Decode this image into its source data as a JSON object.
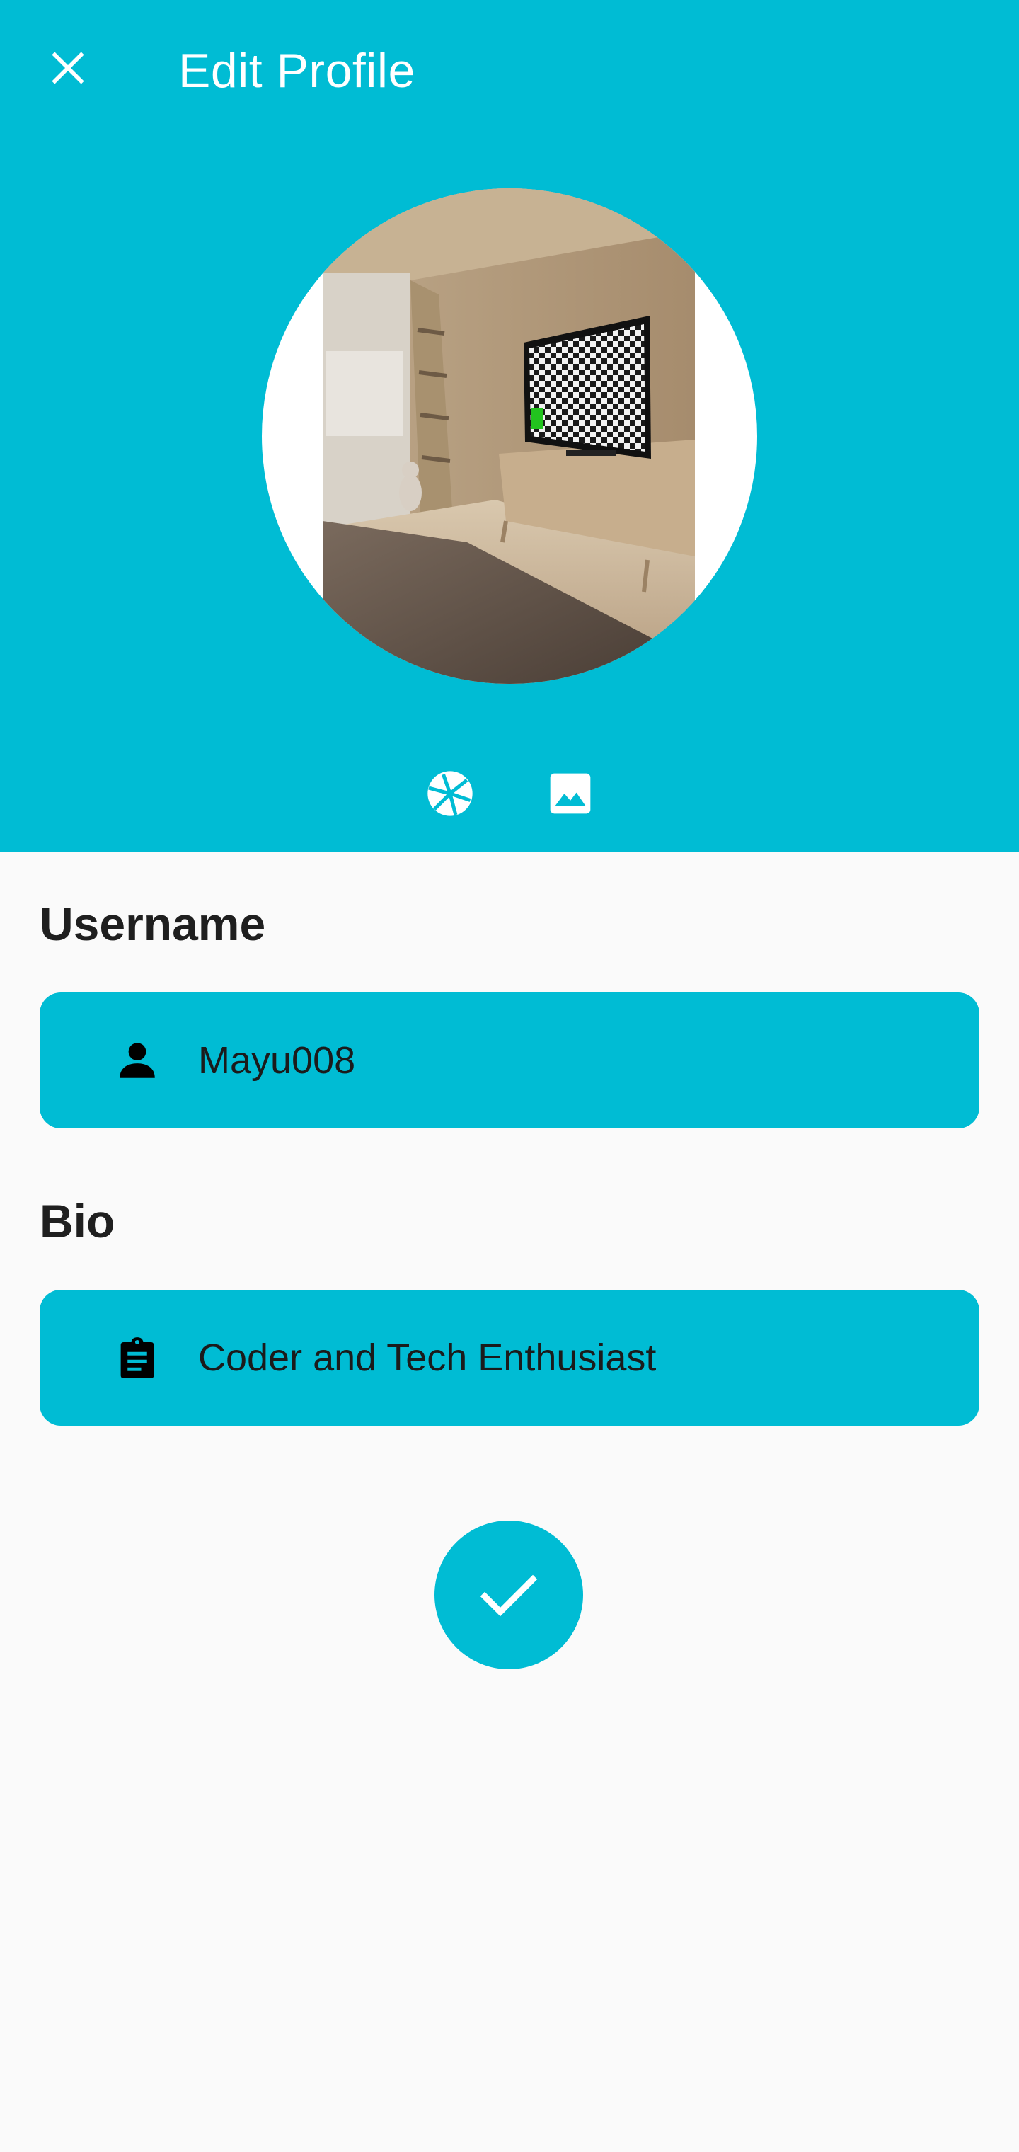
{
  "app_bar": {
    "title": "Edit Profile",
    "close_icon": "close-icon",
    "background_color": "#00bcd4"
  },
  "avatar": {
    "description_icon": "profile-photo",
    "camera_icon": "camera-shutter-icon",
    "gallery_icon": "image-icon"
  },
  "form": {
    "username": {
      "label": "Username",
      "value": "Mayu008",
      "icon": "person-icon"
    },
    "bio": {
      "label": "Bio",
      "value": "Coder and Tech Enthusiast",
      "icon": "clipboard-icon"
    }
  },
  "submit": {
    "icon": "check-icon",
    "color": "#00bcd4"
  }
}
